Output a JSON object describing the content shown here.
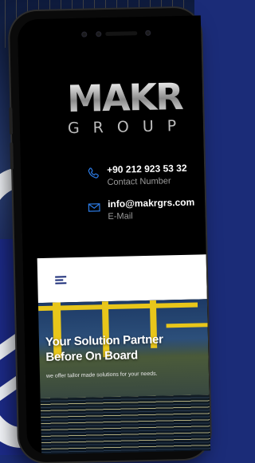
{
  "brand": {
    "logo_mark": "MAKR",
    "logo_group": "GROUP"
  },
  "contact": {
    "phone": {
      "value": "+90 212 923 53 32",
      "label": "Contact Number",
      "icon": "phone-icon"
    },
    "email": {
      "value": "info@makrgrs.com",
      "label": "E-Mail",
      "icon": "envelope-icon"
    }
  },
  "nav": {
    "menu_icon": "hamburger-menu-icon"
  },
  "hero": {
    "title": "Your Solution Partner Before On Board",
    "subtitle": "we offer tailor made solutions for your needs."
  },
  "colors": {
    "accent": "#2c7be5",
    "navy": "#1c2a86",
    "crane_yellow": "#e8c61a"
  }
}
